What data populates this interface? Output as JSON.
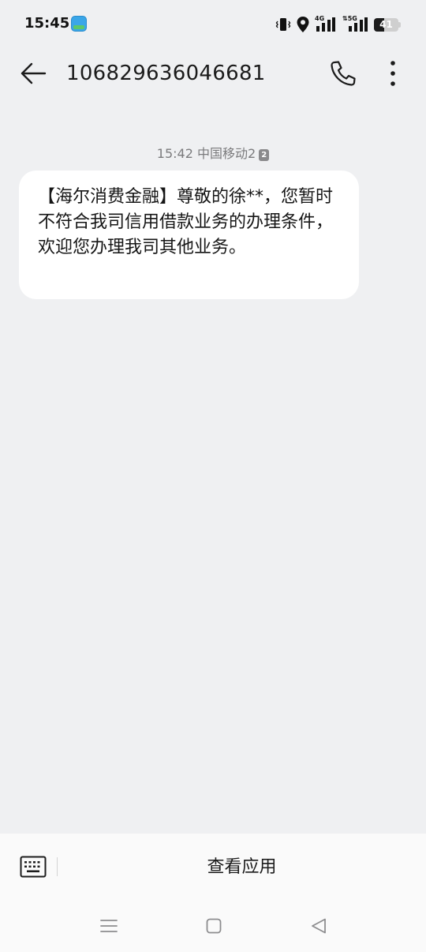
{
  "status_bar": {
    "time": "15:45",
    "app_badge_icon": "app-badge-icon",
    "network_1": "4G",
    "network_2": "5G",
    "battery_level": "41",
    "battery_percent": 41
  },
  "header": {
    "back_icon": "arrow-left-icon",
    "title": "106829636046681",
    "call_icon": "phone-icon",
    "more_icon": "more-vertical-icon"
  },
  "conversation": {
    "meta": {
      "time": "15:42",
      "carrier": "中国移动2",
      "sim": "2"
    },
    "message": {
      "text": "【海尔消费金融】尊敬的徐**，您暂时不符合我司信用借款业务的办理条件，欢迎您办理我司其他业务。"
    }
  },
  "bottom_bar": {
    "keyboard_icon": "keyboard-icon",
    "view_apps_label": "查看应用"
  },
  "nav_bar": {
    "menu_icon": "menu-icon",
    "home_icon": "home-icon",
    "back_icon": "back-triangle-icon"
  }
}
